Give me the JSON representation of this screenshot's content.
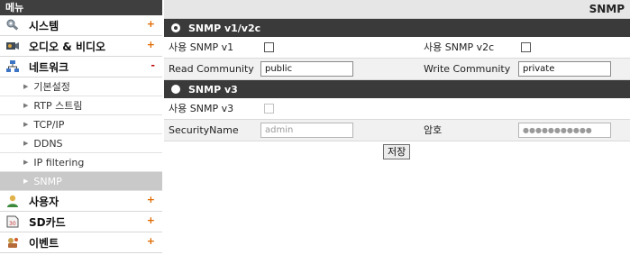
{
  "sidebar": {
    "header": "메뉴",
    "items": [
      {
        "label": "시스템",
        "icon": "tools-icon",
        "expander": "+"
      },
      {
        "label": "오디오 & 비디오",
        "icon": "camera-icon",
        "expander": "+"
      },
      {
        "label": "네트워크",
        "icon": "network-icon",
        "expander": "-"
      }
    ],
    "network_sub": [
      {
        "label": "기본설정"
      },
      {
        "label": "RTP 스트림"
      },
      {
        "label": "TCP/IP"
      },
      {
        "label": "DDNS"
      },
      {
        "label": "IP filtering"
      },
      {
        "label": "SNMP"
      }
    ],
    "items_after": [
      {
        "label": "사용자",
        "icon": "user-icon",
        "expander": "+"
      },
      {
        "label": "SD카드",
        "icon": "sd-card-icon",
        "expander": "+"
      },
      {
        "label": "이벤트",
        "icon": "event-icon",
        "expander": "+"
      }
    ]
  },
  "main": {
    "title": "SNMP",
    "v1v2c": {
      "section_label": "SNMP v1/v2c",
      "use_v1_label": "사용 SNMP v1",
      "use_v2c_label": "사용  SNMP v2c",
      "read_community_label": "Read Community",
      "read_community_value": "public",
      "write_community_label": "Write Community",
      "write_community_value": "private"
    },
    "v3": {
      "section_label": "SNMP v3",
      "use_v3_label": "사용 SNMP v3",
      "security_name_label": "SecurityName",
      "security_name_value": "admin",
      "password_label": "암호",
      "password_value": "●●●●●●●●●●●"
    },
    "save_label": "저장"
  },
  "colors": {
    "section_bar": "#3a3a3a",
    "sidebar_header": "#3f3f3f",
    "active_sub_item": "#c9c9c9",
    "expander_plus": "#e06a00"
  }
}
